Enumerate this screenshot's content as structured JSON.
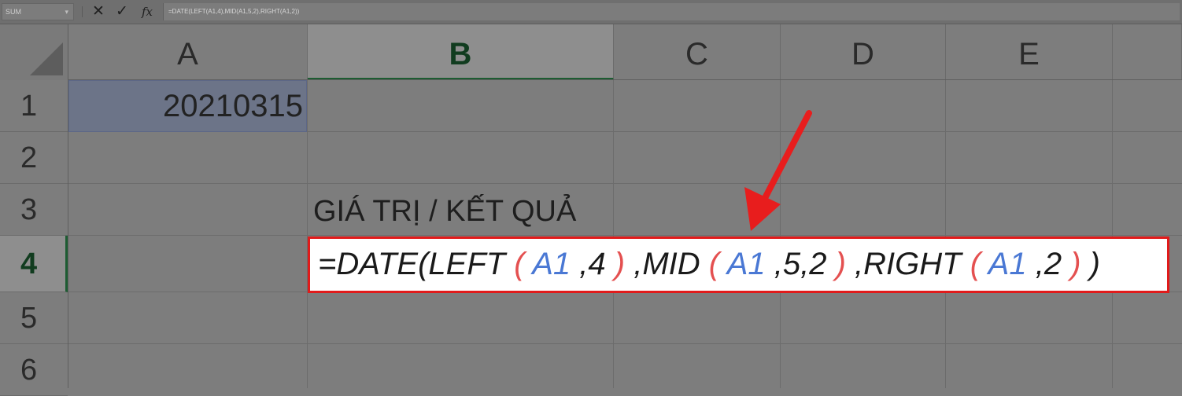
{
  "formula_bar": {
    "name_box": "SUM",
    "cancel_icon": "✕",
    "enter_icon": "✓",
    "fx_label": "fx",
    "content": "=DATE(LEFT(A1,4),MID(A1,5,2),RIGHT(A1,2))"
  },
  "columns": [
    "A",
    "B",
    "C",
    "D",
    "E"
  ],
  "rows": [
    "1",
    "2",
    "3",
    "4",
    "5",
    "6"
  ],
  "cells": {
    "A1": "20210315",
    "B3": "GIÁ TRỊ / KẾT QUẢ"
  },
  "formula_display": {
    "prefix": "=DATE(LEFT",
    "open1": " ( ",
    "ref1": "A1",
    "arg1": " ,4",
    "close1": " ) ",
    "sep_mid": ",MID",
    "open2": " ( ",
    "ref2": "A1",
    "arg2": " ,5,2",
    "close2": " ) ",
    "sep_right": ",RIGHT",
    "open3": " ( ",
    "ref3": "A1",
    "arg3": " ,2",
    "close3": " ) ",
    "final": ")"
  },
  "colors": {
    "highlight_border": "#e11b1b",
    "arrow": "#e81d1d",
    "reference": "#4a78d4",
    "paren": "#e45050",
    "active_header": "#1d5c32"
  },
  "icons": [
    "cancel-icon",
    "check-icon",
    "fx-icon",
    "dropdown-icon",
    "arrow-icon"
  ]
}
